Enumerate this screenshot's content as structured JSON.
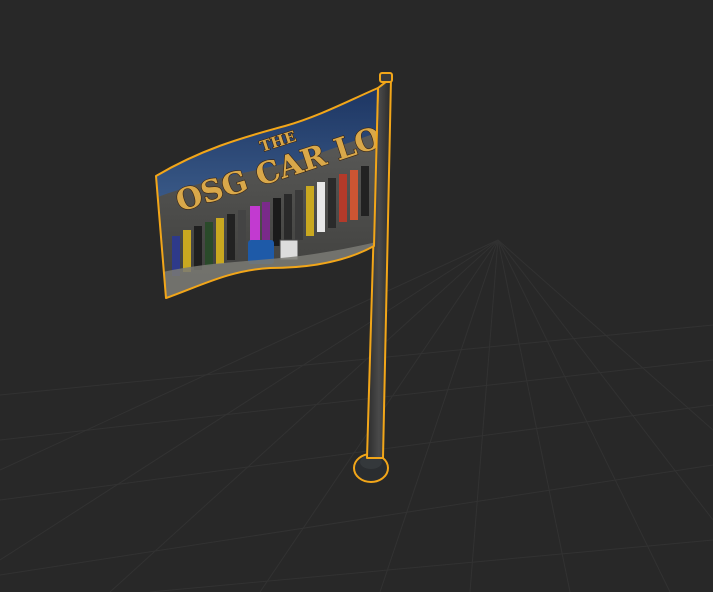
{
  "viewport": {
    "background": "#282828",
    "grid_color": "#333333",
    "selection_outline_color": "#f2a619"
  },
  "flag": {
    "title_small": "THE",
    "title_main": "OSG CAR LOT",
    "title_color": "#d9a84a",
    "sky_color": "#1e3a6b",
    "wall_color": "#6e6e6e"
  },
  "pole": {
    "color": "#3a3a3a",
    "base_color": "#2a2d30"
  }
}
